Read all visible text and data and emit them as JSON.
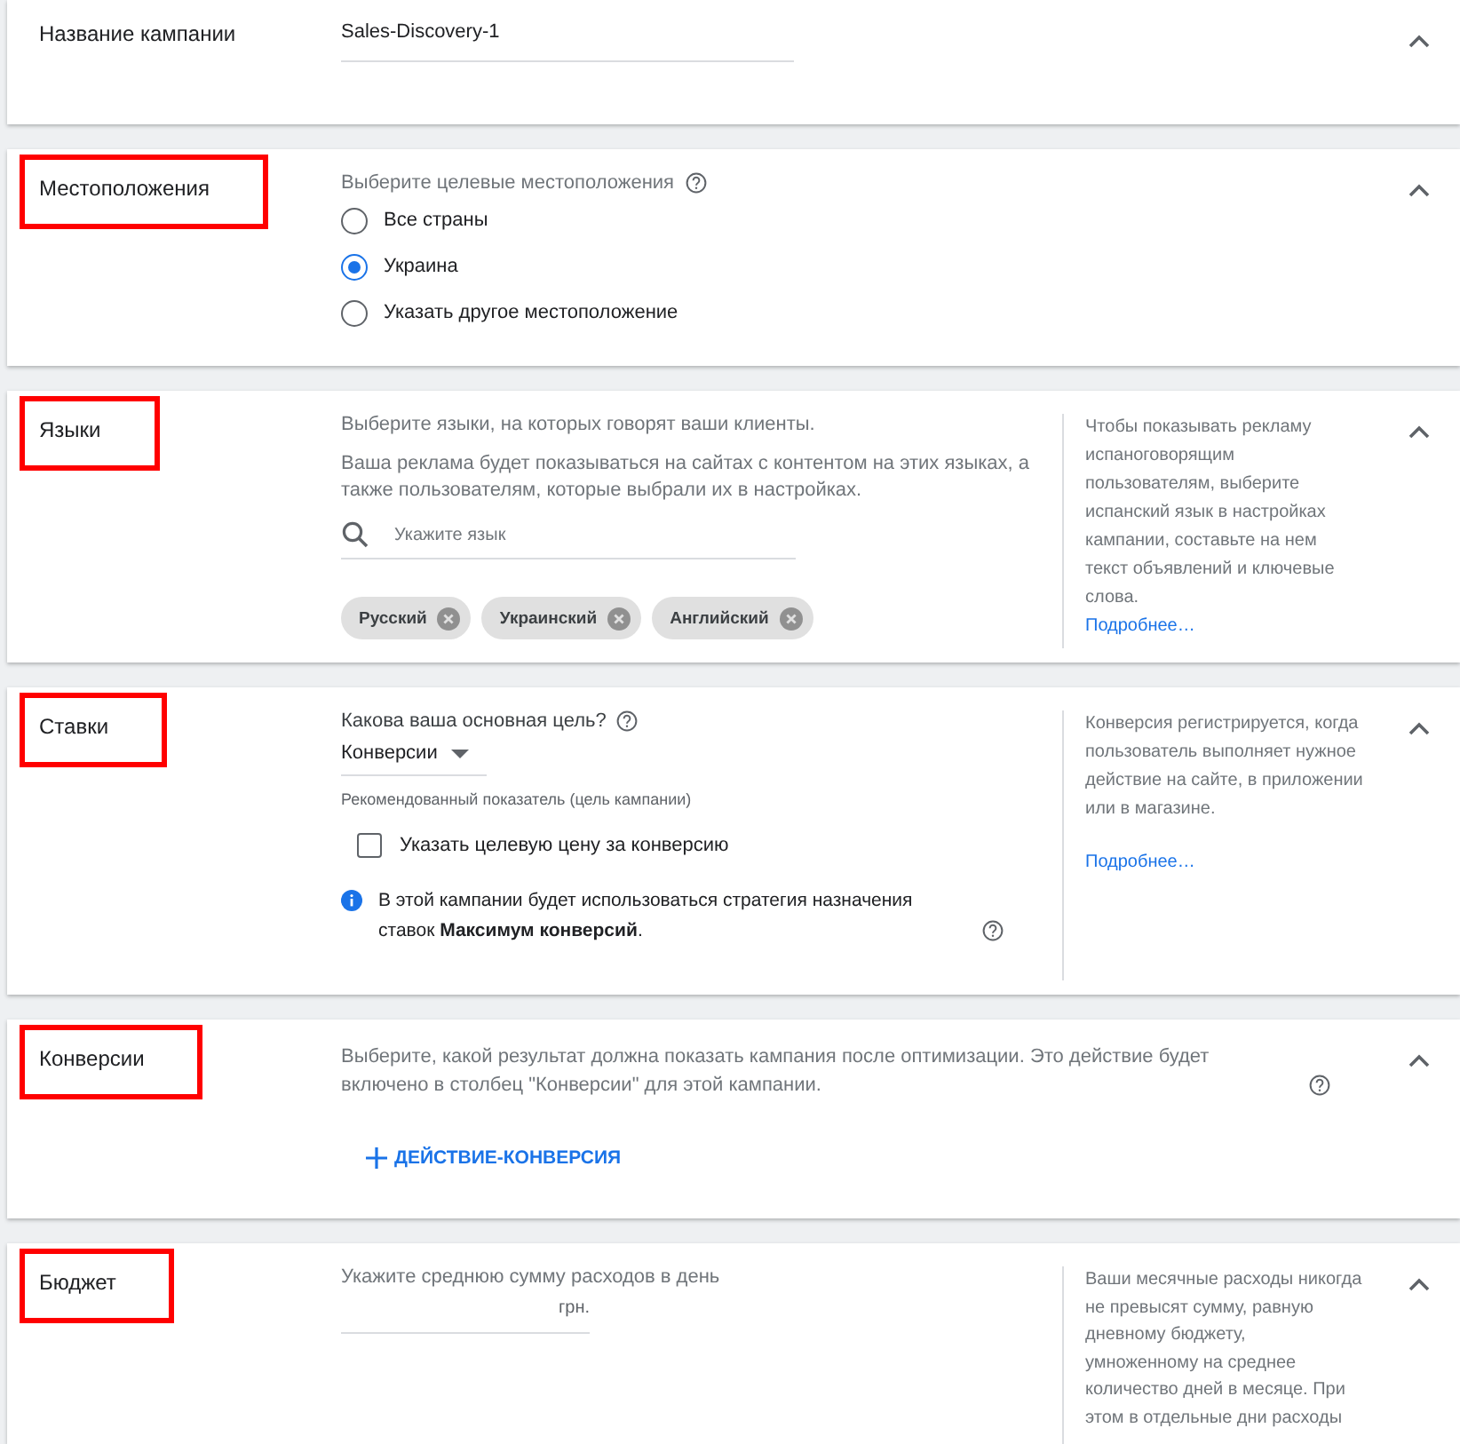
{
  "sections": [
    {
      "kind": "name",
      "title": "Название кампании",
      "highlighted": false,
      "value": "Sales-Discovery-1"
    },
    {
      "kind": "locations",
      "title": "Местоположения",
      "highlighted": true,
      "prompt": "Выберите целевые местоположения",
      "options": [
        {
          "label": "Все страны",
          "selected": false
        },
        {
          "label": "Украина",
          "selected": true
        },
        {
          "label": "Указать другое местоположение",
          "selected": false
        }
      ]
    },
    {
      "kind": "languages",
      "title": "Языки",
      "highlighted": true,
      "prompt": "Выберите языки, на которых говорят ваши клиенты.",
      "description": "Ваша реклама будет показываться на сайтах с контентом на этих языках, а также пользователям, которые выбрали их в настройках.",
      "search": {
        "placeholder": "Укажите язык"
      },
      "chips": [
        "Русский",
        "Украинский",
        "Английский"
      ],
      "aside": {
        "text": "Чтобы показывать рекламу испаноговорящим пользователям, выберите испанский язык в настройках кампании, составьте на нем текст объявлений и ключевые слова.",
        "link": "Подробнее…"
      }
    },
    {
      "kind": "bidding",
      "title": "Ставки",
      "highlighted": true,
      "question": "Какова ваша основная цель?",
      "dropdown": {
        "value": "Конверсии"
      },
      "hint": "Рекомендованный показатель (цель кампании)",
      "checkbox": {
        "label": "Указать целевую цену за конверсию",
        "checked": false
      },
      "info": "В этой кампании будет использоваться стратегия назначения ставок **Максимум конверсий**.",
      "aside": {
        "text": "Конверсия регистрируется, когда пользователь выполняет нужное действие на сайте, в приложении или в магазине.",
        "link": "Подробнее…"
      }
    },
    {
      "kind": "conversions",
      "title": "Конверсии",
      "highlighted": true,
      "description": "Выберите, какой результат должна показать кампания после оптимизации. Это действие будет включено в столбец \"Конверсии\" для этой кампании.",
      "action": "ДЕЙСТВИЕ-КОНВЕРСИЯ"
    },
    {
      "kind": "budget",
      "title": "Бюджет",
      "highlighted": true,
      "prompt": "Укажите среднюю сумму расходов в день",
      "currency": "грн.",
      "aside": {
        "text": "Ваши месячные расходы никогда не превысят сумму, равную дневному бюджету, умноженному на среднее количество дней в месяце. При этом в отдельные дни расходы"
      }
    }
  ]
}
